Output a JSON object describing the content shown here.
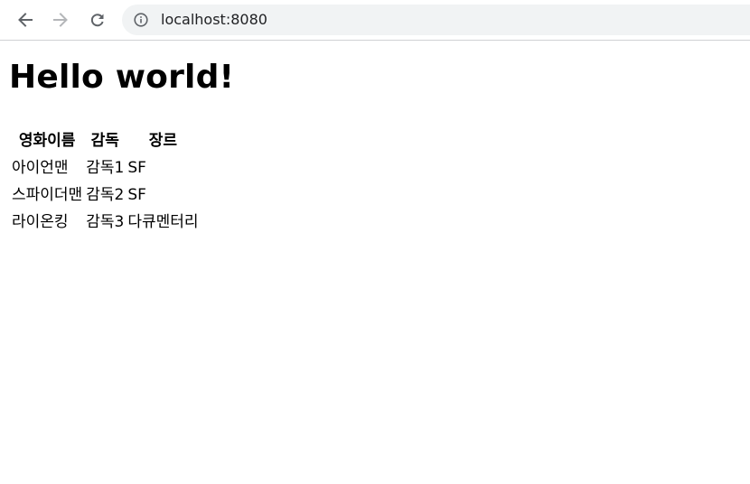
{
  "browser": {
    "url": "localhost:8080",
    "icons": {
      "back": "arrow-left-icon",
      "forward": "arrow-right-icon",
      "reload": "reload-icon",
      "site_info": "info-icon"
    }
  },
  "page": {
    "heading": "Hello world!",
    "table": {
      "headers": [
        "영화이름",
        "감독",
        "장르"
      ],
      "rows": [
        [
          "아이언맨",
          "감독1",
          "SF"
        ],
        [
          "스파이더맨",
          "감독2",
          "SF"
        ],
        [
          "라이온킹",
          "감독3",
          "다큐멘터리"
        ]
      ]
    }
  }
}
